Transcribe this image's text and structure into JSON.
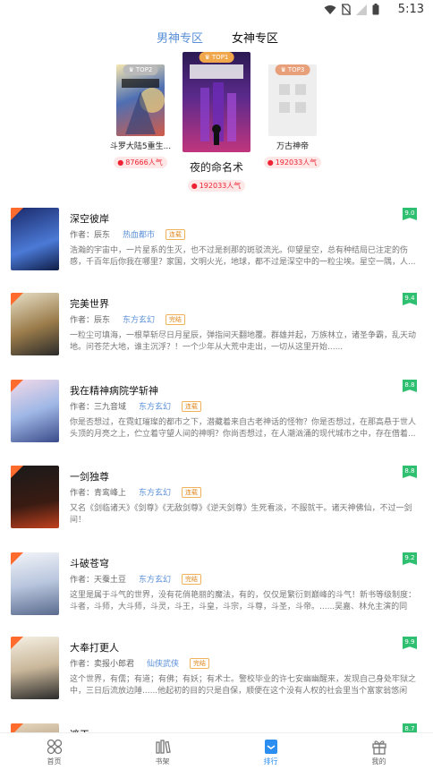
{
  "status_bar": {
    "time": "5:13",
    "icons": [
      "wifi-icon",
      "no-sim-icon",
      "signal-icon",
      "battery-icon"
    ]
  },
  "tabs": [
    {
      "label": "男神专区",
      "active": false
    },
    {
      "label": "女神专区",
      "active": true
    }
  ],
  "podium": [
    {
      "rank_label": "TOP2",
      "title": "斗罗大陆5重生...",
      "heat": "87666人气",
      "rank": 2
    },
    {
      "rank_label": "TOP1",
      "title": "夜的命名术",
      "heat": "192033人气",
      "rank": 1
    },
    {
      "rank_label": "TOP3",
      "title": "万古神帝",
      "heat": "192033人气",
      "rank": 3
    }
  ],
  "books": [
    {
      "title": "深空彼岸",
      "author": "作者：辰东",
      "category": "热血都市",
      "status": "连载",
      "score": "9.0",
      "desc": "浩瀚的宇宙中，一片星系的生灭，也不过是刹那的斑驳流光。仰望星空，总有种结局已注定的伤感，千百年后你我在哪里？家国，文明火光，地球，都不过是深空中的一粒尘埃。星空一隅，人..."
    },
    {
      "title": "完美世界",
      "author": "作者：辰东",
      "category": "东方玄幻",
      "status": "完结",
      "score": "9.4",
      "desc": "一粒尘可填海，一根草斩尽日月星辰，弹指间天翻地覆。群雄并起，万族林立，诸圣争霸，乱天动地。问苍茫大地，谁主沉浮？！一个少年从大荒中走出，一切从这里开始......"
    },
    {
      "title": "我在精神病院学斩神",
      "author": "作者：三九音域",
      "category": "东方玄幻",
      "status": "连载",
      "score": "8.8",
      "desc": "你是否想过，在霓虹璀璨的都市之下，潜藏着来自古老神话的怪物？你是否想过，在那高悬于世人头顶的月亮之上，伫立着守望人间的神明？你尚否想过，在人潮汹涌的现代城市之中，存在借着..."
    },
    {
      "title": "一剑独尊",
      "author": "作者：青鸾峰上",
      "category": "东方玄幻",
      "status": "连载",
      "score": "8.8",
      "desc": "又名《剑临诸天》《剑尊》《无敌剑尊》《逆天剑尊》生死看淡，不服就干。诸天神佛仙，不过一剑间！"
    },
    {
      "title": "斗破苍穹",
      "author": "作者：天蚕土豆",
      "category": "东方玄幻",
      "status": "完结",
      "score": "9.2",
      "desc": "这里是属于斗气的世界，没有花俏艳丽的魔法，有的，仅仅是繁衍到巅峰的斗气！新书等级制度：斗者，斗师，大斗师，斗灵，斗王，斗皇，斗宗，斗尊，斗圣，斗帝。......吴嘉、林允主演的同名..."
    },
    {
      "title": "大奉打更人",
      "author": "作者：卖报小郎君",
      "category": "仙侠武侠",
      "status": "完结",
      "score": "9.9",
      "desc": "这个世界，有儒；有道；有佛；有妖；有术士。警校毕业的许七安幽幽醒来，发现自己身处牢狱之中，三日后流放边陲......他起初的目的只是自保，顺便在这个没有人权的社会里当个富家翁悠闲度..."
    },
    {
      "title": "遮天",
      "author": "",
      "category": "",
      "status": "",
      "score": "8.7",
      "desc": ""
    }
  ],
  "tabbar": [
    {
      "label": "首页",
      "icon": "home-grid-icon",
      "active": false
    },
    {
      "label": "书架",
      "icon": "bookshelf-icon",
      "active": false
    },
    {
      "label": "排行",
      "icon": "ranking-icon",
      "active": true
    },
    {
      "label": "我的",
      "icon": "gift-profile-icon",
      "active": false
    }
  ],
  "colors": {
    "accent_blue": "#2b8ef0",
    "tab_blue": "#5a8fd8",
    "score_green": "#2fbf71",
    "heat_red": "#e23",
    "top1": "#f0a64a",
    "top2": "#b9b9b9",
    "top3": "#e7a07a"
  }
}
